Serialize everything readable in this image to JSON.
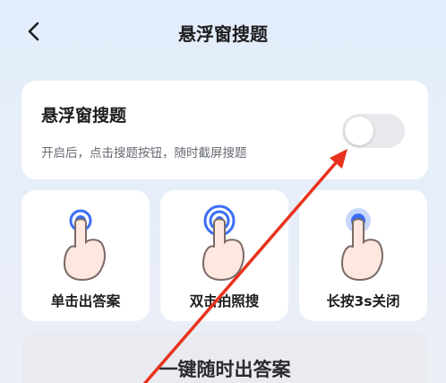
{
  "header": {
    "title": "悬浮窗搜题",
    "back_icon": "chevron-left-icon"
  },
  "floating_window": {
    "title": "悬浮窗搜题",
    "description": "开启后，点击搜题按钮，随时截屏搜题",
    "enabled": false
  },
  "modes": [
    {
      "label": "单击出答案",
      "icon": "single-tap-icon"
    },
    {
      "label": "双击拍照搜",
      "icon": "double-tap-icon"
    },
    {
      "label": "长按3s关闭",
      "icon": "long-press-icon"
    }
  ],
  "banner": {
    "text": "一键随时出答案"
  },
  "colors": {
    "accent": "#3b6ef5",
    "annotation_arrow": "#e8321d",
    "hand_skin": "#fde7df",
    "hand_outline": "#7a6a66"
  }
}
